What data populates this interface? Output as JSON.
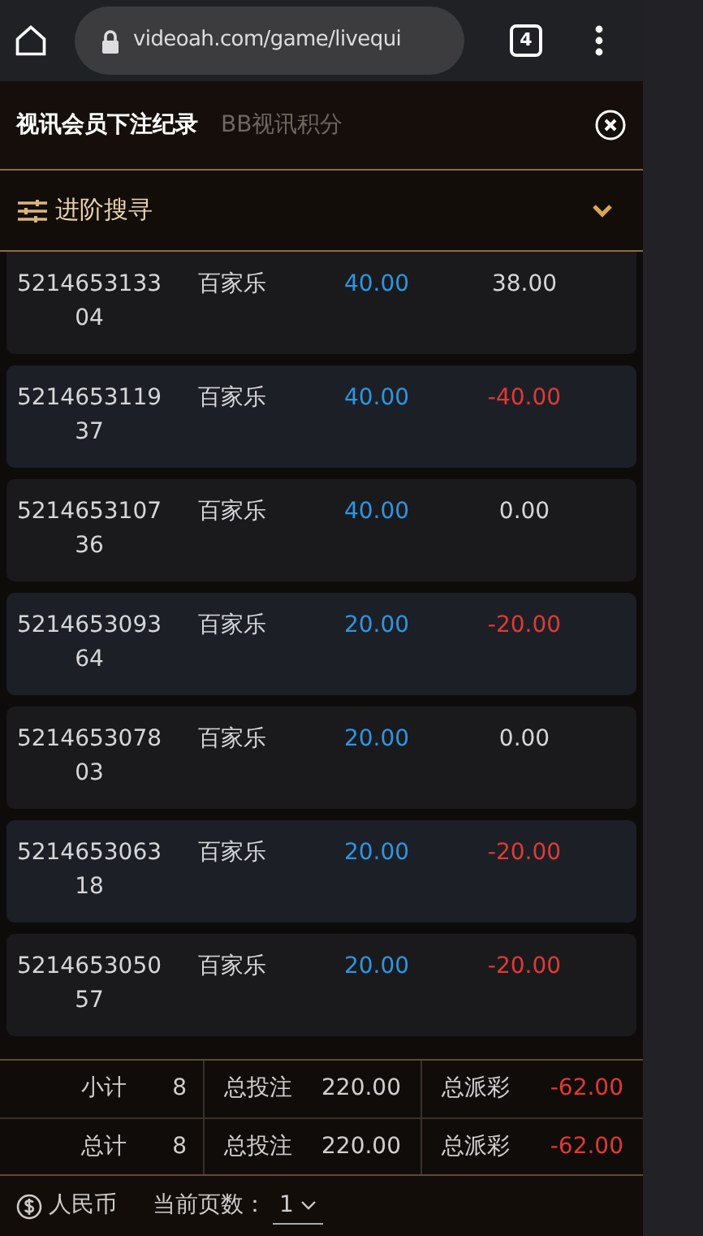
{
  "browser": {
    "url": "videoah.com/game/livequi",
    "tab_count": "4"
  },
  "tabs": [
    {
      "label": "视讯会员下注纪录",
      "selected": true
    },
    {
      "label": "BB视讯积分",
      "selected": false
    }
  ],
  "search": {
    "label": "进阶搜寻",
    "expanded": false
  },
  "rows": [
    {
      "id": "521465313304",
      "game": "百家乐",
      "bet": "40.00",
      "payout": "38.00",
      "loss": false
    },
    {
      "id": "521465311937",
      "game": "百家乐",
      "bet": "40.00",
      "payout": "-40.00",
      "loss": true
    },
    {
      "id": "521465310736",
      "game": "百家乐",
      "bet": "40.00",
      "payout": "0.00",
      "loss": false
    },
    {
      "id": "521465309364",
      "game": "百家乐",
      "bet": "20.00",
      "payout": "-20.00",
      "loss": true
    },
    {
      "id": "521465307803",
      "game": "百家乐",
      "bet": "20.00",
      "payout": "0.00",
      "loss": false
    },
    {
      "id": "521465306318",
      "game": "百家乐",
      "bet": "20.00",
      "payout": "-20.00",
      "loss": true
    },
    {
      "id": "521465305057",
      "game": "百家乐",
      "bet": "20.00",
      "payout": "-20.00",
      "loss": true
    }
  ],
  "summary": [
    {
      "label": "小计",
      "count": "8",
      "bet_label": "总投注",
      "bet": "220.00",
      "payout_label": "总派彩",
      "payout": "-62.00"
    },
    {
      "label": "总计",
      "count": "8",
      "bet_label": "总投注",
      "bet": "220.00",
      "payout_label": "总派彩",
      "payout": "-62.00"
    }
  ],
  "footer": {
    "currency": "人民币",
    "page_label": "当前页数：",
    "page": "1"
  }
}
